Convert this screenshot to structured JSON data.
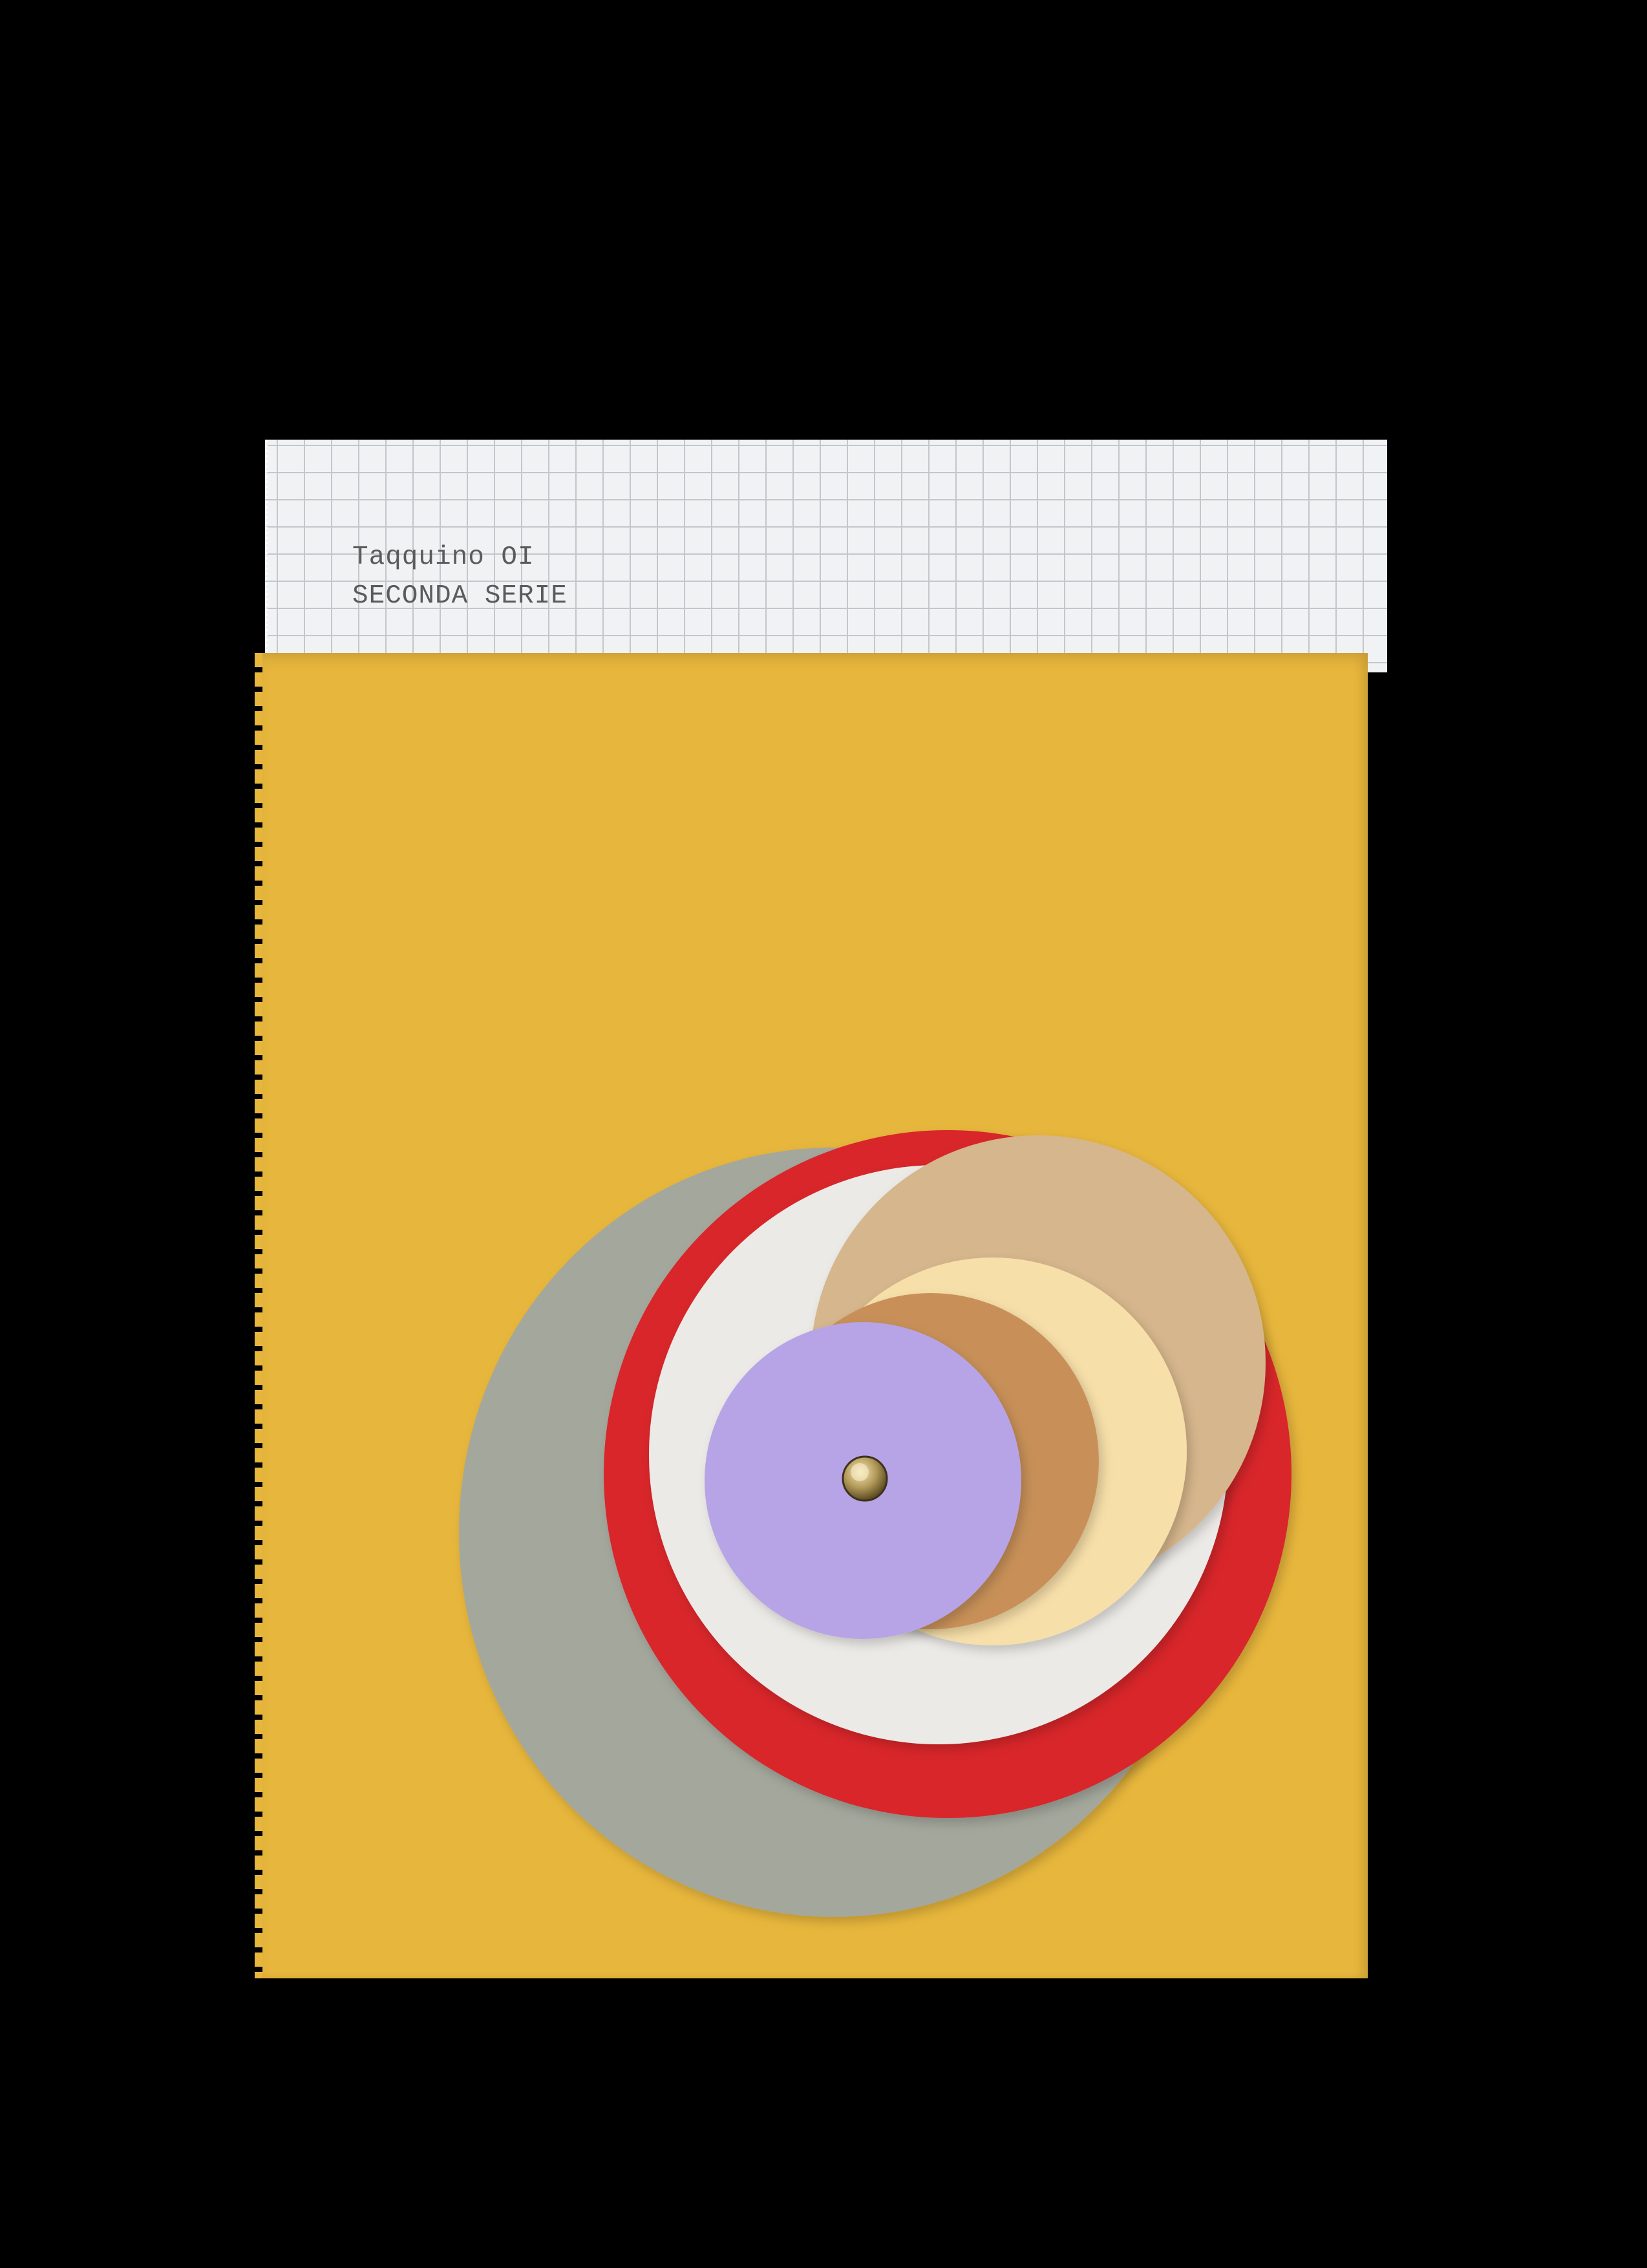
{
  "notebook": {
    "title_line_1": "Taqquino OI",
    "title_line_2": "SECONDA SERIE"
  },
  "colors": {
    "background": "#000000",
    "cover": "#e7b63c",
    "grid_paper": "#f1f2f4",
    "grid_lines": "#c4c6ca",
    "label_text": "#5b5b5b",
    "disc_gray": "#a4a79c",
    "disc_red": "#d8262a",
    "disc_white": "#eceae6",
    "disc_tan": "#d6b68c",
    "disc_cream": "#f7dfa9",
    "disc_brown": "#c89058",
    "disc_lavender": "#b7a4e6",
    "rivet": "#b49a5a"
  }
}
